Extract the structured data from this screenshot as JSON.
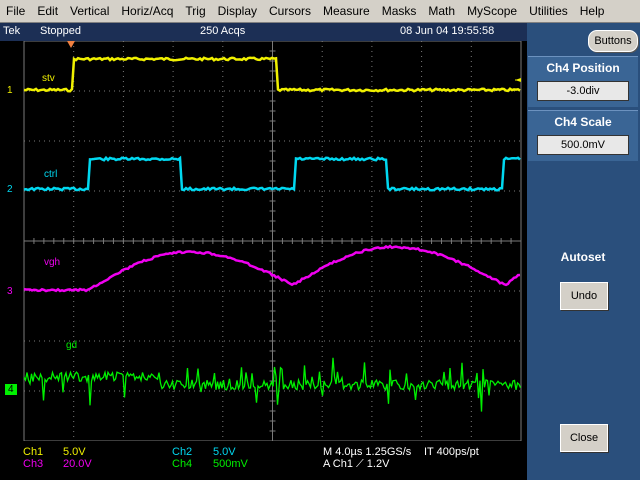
{
  "menu": [
    "File",
    "Edit",
    "Vertical",
    "Horiz/Acq",
    "Trig",
    "Display",
    "Cursors",
    "Measure",
    "Masks",
    "Math",
    "MyScope",
    "Utilities",
    "Help"
  ],
  "status": {
    "brand": "Tek",
    "state": "Stopped",
    "acqs": "250 Acqs",
    "datetime": "08 Jun 04 19:55:58"
  },
  "buttons_label": "Buttons",
  "ch4_position": {
    "title": "Ch4 Position",
    "value": "-3.0div"
  },
  "ch4_scale": {
    "title": "Ch4 Scale",
    "value": "500.0mV"
  },
  "autoset": {
    "title": "Autoset",
    "undo": "Undo"
  },
  "close_label": "Close",
  "channels": {
    "ch1": {
      "marker": "1",
      "label": "stv",
      "color": "#f0f000"
    },
    "ch2": {
      "marker": "2",
      "label": "ctrl",
      "color": "#00d8f0"
    },
    "ch3": {
      "marker": "3",
      "label": "vgh",
      "color": "#f000f0"
    },
    "ch4": {
      "marker": "4",
      "label": "gd",
      "color": "#00f000"
    }
  },
  "readout": {
    "ch1": {
      "name": "Ch1",
      "value": "5.0V"
    },
    "ch2": {
      "name": "Ch2",
      "value": "5.0V"
    },
    "ch3": {
      "name": "Ch3",
      "value": "20.0V"
    },
    "ch4": {
      "name": "Ch4",
      "value": "500mV"
    },
    "timebase": "M 4.0µs 1.25GS/s",
    "interp": "IT 400ps/pt",
    "trigger": "A  Ch1  ⟋  1.2V"
  },
  "colors": {
    "grid": "#7a7a7a",
    "panel": "#2a4f7c",
    "trigger_marker": "#f08040"
  },
  "icons": [
    "trigger-position-icon",
    "trigger-level-arrow-icon",
    "rising-edge-icon"
  ]
}
